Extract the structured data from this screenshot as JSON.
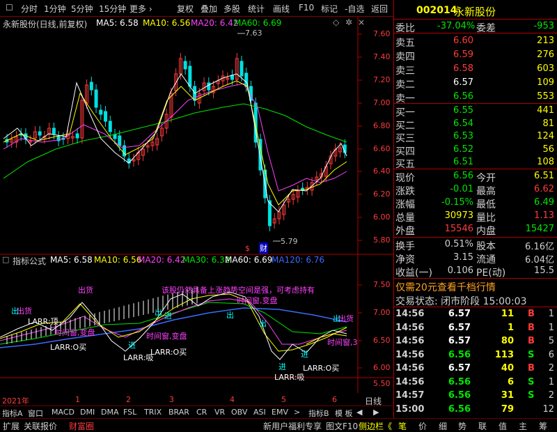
{
  "toolbar": {
    "left": [
      "分时",
      "1分钟",
      "5分钟",
      "15分钟",
      "更多 ›"
    ],
    "right": [
      "复权",
      "叠加",
      "多股",
      "统计",
      "画线",
      "F10",
      "标记",
      "-自选",
      "返回"
    ]
  },
  "kline": {
    "title": "永新股份(日线,前复权)",
    "ma5": "MA5: 6.58",
    "ma10": "MA10: 6.56",
    "ma20": "MA20: 6.42",
    "ma60": "MA60: 6.69",
    "high_label": "7.63",
    "low_label": "5.79",
    "event_s": "$",
    "event_cai": "财",
    "y_ticks": [
      "7.60",
      "7.40",
      "7.20",
      "7.00",
      "6.80",
      "6.60",
      "6.40",
      "6.20",
      "6.00",
      "5.80"
    ]
  },
  "indicator": {
    "title": "指标公式",
    "ma5": "MA5: 6.58",
    "ma10": "MA10: 6.56",
    "ma20": "MA20: 6.42",
    "ma30": "MA30: 6.32",
    "ma60": "MA60: 6.69",
    "ma120": "MA120: 6.76",
    "y_ticks": [
      "7.50",
      "7.00",
      "6.50",
      "6.00",
      "5.50"
    ],
    "notice": "该股仍然具备上涨趋势空间是强，可考虑持有",
    "ann": {
      "chuhuo1": "出货",
      "chuhuo2": "出货",
      "chuhuo3": "出货",
      "larr_top": "LARR:顶",
      "chu1": "出",
      "chu2": "出",
      "chu3": "出",
      "time_window1": "时间窗,变盘",
      "time_window2": "时间窗,变盘",
      "time_window3": "时间窗,变盘",
      "time_window4": "时间窗,3",
      "larr_buy1": "LARR:O买",
      "larr_buy2": "LARR:O买",
      "larr_buy3": "LARR:O买",
      "larr_suck1": "LARR:吸",
      "larr_suck2": "LARR:吸",
      "jin1": "进",
      "jin2": "进",
      "jin3": "进",
      "jin4": "进",
      "ro1": "出",
      "ro2": "出"
    }
  },
  "time_axis": {
    "year": "2021年",
    "months": [
      "1",
      "2",
      "3",
      "4",
      "5",
      "6"
    ],
    "period": "日线"
  },
  "tabs": [
    "指标A",
    "窗口",
    "MACD",
    "DMI",
    "DMA",
    "FSL",
    "TRIX",
    "BRAR",
    "CR",
    "VR",
    "OBV",
    "ASI",
    "EMV"
  ],
  "tabs_right": [
    "指标B",
    "模 板"
  ],
  "bottom": {
    "left": [
      "扩展",
      "关联报价",
      "财富圈"
    ],
    "right": [
      "新用户福利专享",
      "图文F10",
      "侧边栏《"
    ],
    "side": [
      "笔",
      "价",
      "细",
      "势",
      "联",
      "值",
      "主",
      "筹"
    ]
  },
  "quote": {
    "code": "002014",
    "name": "永新股份",
    "weibi_label": "委比",
    "weibi": "-37.04%",
    "weicha_label": "委差",
    "weicha": "-953",
    "asks": [
      {
        "label": "卖五",
        "price": "6.60",
        "vol": "213"
      },
      {
        "label": "卖四",
        "price": "6.59",
        "vol": "276"
      },
      {
        "label": "卖三",
        "price": "6.58",
        "vol": "603"
      },
      {
        "label": "卖二",
        "price": "6.57",
        "vol": "109"
      },
      {
        "label": "卖一",
        "price": "6.56",
        "vol": "553"
      }
    ],
    "bids": [
      {
        "label": "买一",
        "price": "6.55",
        "vol": "441"
      },
      {
        "label": "买二",
        "price": "6.54",
        "vol": "81"
      },
      {
        "label": "买三",
        "price": "6.53",
        "vol": "124"
      },
      {
        "label": "买四",
        "price": "6.52",
        "vol": "56"
      },
      {
        "label": "买五",
        "price": "6.51",
        "vol": "108"
      }
    ],
    "stats": [
      {
        "l1": "现价",
        "v1": "6.56",
        "l2": "今开",
        "v2": "6.51"
      },
      {
        "l1": "涨跌",
        "v1": "-0.01",
        "l2": "最高",
        "v2": "6.62"
      },
      {
        "l1": "涨幅",
        "v1": "-0.15%",
        "l2": "最低",
        "v2": "6.49"
      },
      {
        "l1": "总量",
        "v1": "30973",
        "l2": "量比",
        "v2": "1.13"
      },
      {
        "l1": "外盘",
        "v1": "15546",
        "l2": "内盘",
        "v2": "15427"
      }
    ],
    "stats2": [
      {
        "l1": "换手",
        "v1": "0.51%",
        "l2": "股本",
        "v2": "6.16亿"
      },
      {
        "l1": "净资",
        "v1": "3.15",
        "l2": "流通",
        "v2": "6.04亿"
      },
      {
        "l1": "收益(一)",
        "v1": "0.106",
        "l2": "PE(动)",
        "v2": "15.5"
      }
    ],
    "promo": "仅需20元查看千档行情",
    "status": "交易状态: 闭市阶段 15:00:03",
    "ticks": [
      {
        "t": "14:56",
        "p": "6.57",
        "v": "11",
        "d": "B",
        "n": "1"
      },
      {
        "t": "14:56",
        "p": "6.57",
        "v": "1",
        "d": "B",
        "n": "1"
      },
      {
        "t": "14:56",
        "p": "6.57",
        "v": "80",
        "d": "B",
        "n": "5"
      },
      {
        "t": "14:56",
        "p": "6.56",
        "v": "113",
        "d": "S",
        "n": "6"
      },
      {
        "t": "14:56",
        "p": "6.57",
        "v": "40",
        "d": "B",
        "n": "2"
      },
      {
        "t": "14:56",
        "p": "6.56",
        "v": "6",
        "d": "S",
        "n": "1"
      },
      {
        "t": "14:57",
        "p": "6.56",
        "v": "31",
        "d": "S",
        "n": "2"
      },
      {
        "t": "15:00",
        "p": "6.56",
        "v": "79",
        "d": "",
        "n": "12"
      }
    ]
  }
}
